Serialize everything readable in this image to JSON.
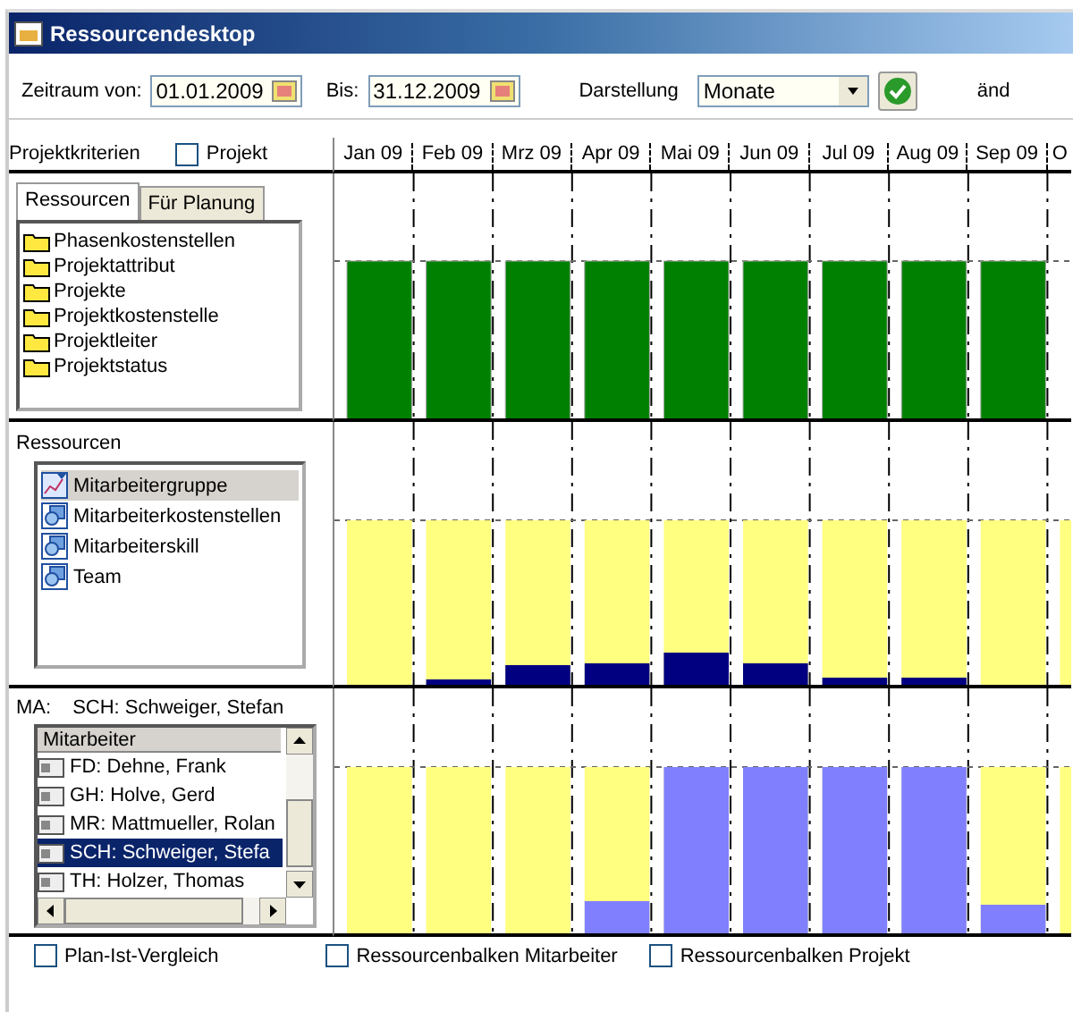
{
  "window": {
    "title": "Ressourcendesktop"
  },
  "toolbar": {
    "from_label": "Zeitraum von:",
    "from_value": "01.01.2009",
    "to_label": "Bis:",
    "to_value": "31.12.2009",
    "view_label": "Darstellung",
    "view_value": "Monate",
    "cut_label": "änd"
  },
  "criteria": {
    "label": "Projektkriterien",
    "project_checkbox": {
      "label": "Projekt",
      "checked": false
    }
  },
  "months": [
    "Jan 09",
    "Feb 09",
    "Mrz 09",
    "Apr 09",
    "Mai 09",
    "Jun 09",
    "Jul 09",
    "Aug 09",
    "Sep 09",
    "O"
  ],
  "tabs": [
    {
      "label": "Ressourcen",
      "selected": true
    },
    {
      "label": "Für Planung",
      "selected": false
    }
  ],
  "criteria_items": [
    "Phasenkostenstellen",
    "Projektattribut",
    "Projekte",
    "Projektkostenstelle",
    "Projektleiter",
    "Projektstatus"
  ],
  "resources": {
    "title": "Ressourcen",
    "items": [
      {
        "label": "Mitarbeitergruppe",
        "kind": "chart",
        "selected": true
      },
      {
        "label": "Mitarbeiterkostenstellen",
        "kind": "group",
        "selected": false
      },
      {
        "label": "Mitarbeiterskill",
        "kind": "group",
        "selected": false
      },
      {
        "label": "Team",
        "kind": "group",
        "selected": false
      }
    ]
  },
  "employee": {
    "prefix": "MA:",
    "name": "SCH: Schweiger, Stefan",
    "list_header": "Mitarbeiter",
    "items": [
      {
        "label": "FD: Dehne, Frank",
        "selected": false
      },
      {
        "label": "GH: Holve, Gerd",
        "selected": false
      },
      {
        "label": "MR: Mattmueller, Rolan",
        "selected": false
      },
      {
        "label": "SCH: Schweiger, Stefa",
        "selected": true
      },
      {
        "label": "TH: Holzer, Thomas",
        "selected": false
      }
    ]
  },
  "options": [
    {
      "label": "Plan-Ist-Vergleich",
      "checked": false
    },
    {
      "label": "Ressourcenbalken Mitarbeiter",
      "checked": false
    },
    {
      "label": "Ressourcenbalken Projekt",
      "checked": false
    }
  ]
}
